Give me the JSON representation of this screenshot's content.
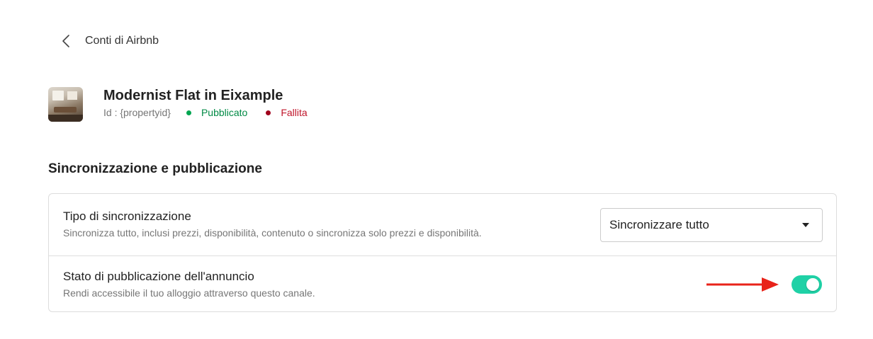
{
  "nav": {
    "back_label": "Conti di Airbnb"
  },
  "property": {
    "title": "Modernist Flat in Eixample",
    "id_text": "Id : {propertyid}",
    "status_published": "Pubblicato",
    "status_failed": "Fallita"
  },
  "section": {
    "title": "Sincronizzazione e pubblicazione"
  },
  "settings": {
    "sync_type": {
      "title": "Tipo di sincronizzazione",
      "description": "Sincronizza tutto, inclusi prezzi, disponibilità, contenuto o sincronizza solo prezzi e disponibilità.",
      "selected_option": "Sincronizzare tutto"
    },
    "publish_state": {
      "title": "Stato di pubblicazione dell'annuncio",
      "description": "Rendi accessibile il tuo alloggio attraverso questo canale.",
      "enabled": true
    }
  },
  "colors": {
    "published": "#00a651",
    "failed": "#a0001c",
    "toggle_on": "#1fd1a6",
    "annotation_arrow": "#e8231a"
  },
  "icons": {
    "back": "chevron-left-icon",
    "dropdown": "caret-down-icon",
    "annotation": "arrow-right-icon"
  }
}
